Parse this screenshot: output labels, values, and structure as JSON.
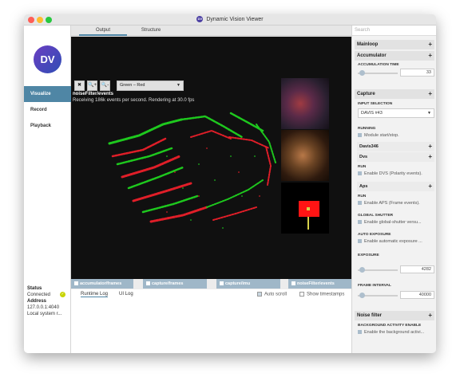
{
  "window": {
    "title": "Dynamic Vision Viewer",
    "title_logo": "DV"
  },
  "sidebar": {
    "logo": "DV",
    "items": [
      {
        "label": "Visualize",
        "active": true
      },
      {
        "label": "Record",
        "active": false
      },
      {
        "label": "Playback",
        "active": false
      }
    ],
    "status": {
      "title": "Status",
      "state": "Connected",
      "address_label": "Address",
      "address": "127.0.0.1:4040",
      "system": "Local system r..."
    }
  },
  "tabs": [
    {
      "label": "Output",
      "active": true
    },
    {
      "label": "Structure",
      "active": false
    }
  ],
  "viewer": {
    "toolbar": {
      "close_icon": "✖",
      "zoom_in_icon": "🔍+",
      "zoom_out_icon": "🔍-",
      "color_mode": "Green – Red"
    },
    "stream_title": "noiseFilter/events",
    "stream_info": "Receiving 186k events per second. Rendering at 30.0 fps"
  },
  "streams": [
    "accumulator/frames",
    "capture/frames",
    "capture/imu",
    "noiseFilter/events"
  ],
  "log": {
    "tabs": [
      {
        "label": "Runtime Log",
        "active": true
      },
      {
        "label": "UI Log",
        "active": false
      }
    ],
    "auto_scroll": "Auto scroll",
    "show_timestamps": "Show timestamps"
  },
  "panel": {
    "search_placeholder": "Search",
    "mainloop": "Mainloop",
    "accumulator": {
      "title": "Accumulator",
      "time_label": "ACCUMULATION TIME",
      "time_value": "33",
      "time_level": 0.05
    },
    "capture": {
      "title": "Capture",
      "input_label": "INPUT SELECTION",
      "input_value": "DAVIS #43",
      "running_label": "RUNNING",
      "running_text": "Module start/stop.",
      "davis_section": "Davis346",
      "dvs_section": "Dvs",
      "dvs_run_label": "RUN",
      "dvs_run_text": "Enable DVS (Polarity events).",
      "aps_section": "Aps",
      "aps_run_label": "RUN",
      "aps_run_text": "Enable APS (Frame events).",
      "global_shutter_label": "GLOBAL SHUTTER",
      "global_shutter_text": "Enable global-shutter versu...",
      "auto_exposure_label": "AUTO EXPOSURE",
      "auto_exposure_text": "Enable automatic exposure ...",
      "exposure_label": "EXPOSURE",
      "exposure_value": "4282",
      "exposure_level": 0.05,
      "frame_interval_label": "FRAME INTERVAL",
      "frame_interval_value": "40000",
      "frame_interval_level": 0.05
    },
    "noise": {
      "title": "Noise filter",
      "bg_label": "BACKGROUND ACTIVITY ENABLE",
      "bg_text": "Enable the background activi..."
    }
  },
  "colors": {
    "accent": "#4f86a5",
    "events_on": "#1ec81e",
    "events_off": "#e01e28"
  }
}
